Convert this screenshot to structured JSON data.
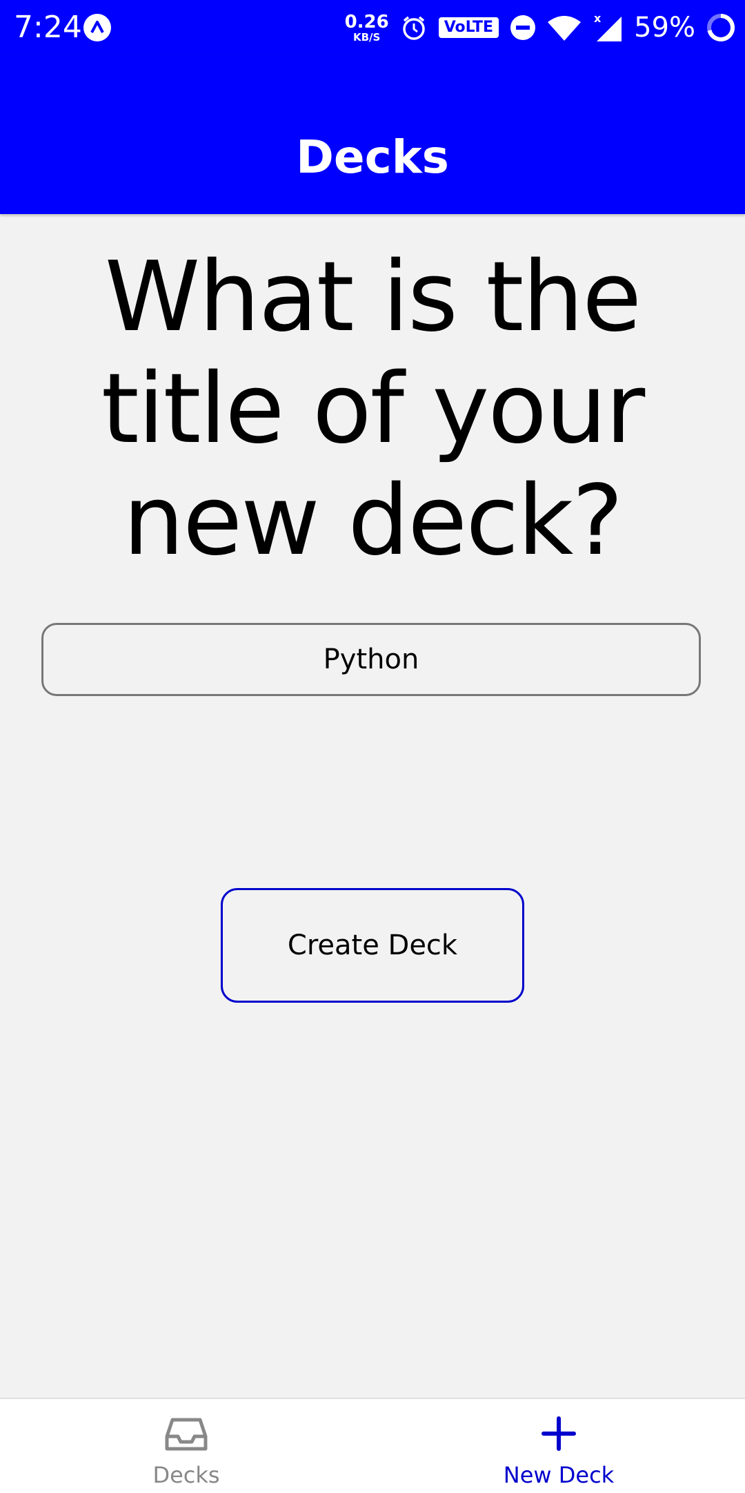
{
  "status_bar": {
    "time": "7:24",
    "net_speed_value": "0.26",
    "net_speed_unit": "KB/S",
    "volte": "VoLTE",
    "battery_percent": "59%"
  },
  "header": {
    "title": "Decks"
  },
  "main": {
    "question": "What is the title of your new deck?",
    "title_input_value": "Python",
    "create_button_label": "Create Deck"
  },
  "tabs": [
    {
      "label": "Decks",
      "icon": "inbox-icon",
      "active": false
    },
    {
      "label": "New Deck",
      "icon": "plus-icon",
      "active": true
    }
  ],
  "colors": {
    "brand": "#0000ff",
    "active_tab": "#0000cc",
    "inactive_tab": "#888888",
    "background": "#f2f2f2"
  }
}
